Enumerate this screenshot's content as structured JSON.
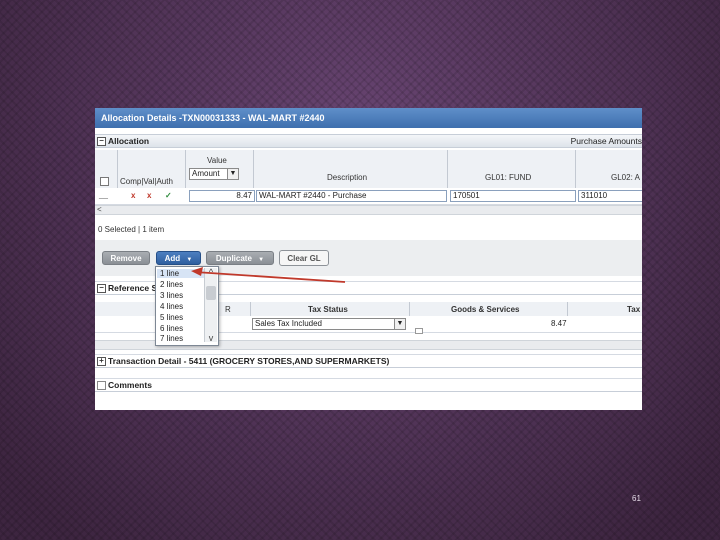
{
  "window": {
    "title": "Allocation Details -TXN00031333 - WAL-MART #2440"
  },
  "allocation": {
    "section_label": "Allocation",
    "right_label": "Purchase Amounts",
    "columns": {
      "value_label": "Value",
      "value_select": "Amount",
      "comp_val_auth": "Comp|Val|Auth",
      "description": "Description",
      "gl01": "GL01: FUND",
      "gl02": "GL02: A"
    },
    "row": {
      "flag1": "x",
      "flag2": "x",
      "flag3": "✓",
      "amount": "8.47",
      "description": "WAL-MART #2440 - Purchase",
      "gl01": "170501",
      "gl02": "311010"
    },
    "scroll_left": "<",
    "selected_text": "0 Selected | 1 item"
  },
  "buttons": {
    "remove": "Remove",
    "add": "Add",
    "add_arrow": "▼",
    "duplicate": "Duplicate",
    "duplicate_arrow": "▼",
    "clear_gl": "Clear GL"
  },
  "add_menu": {
    "items": [
      "1 line",
      "2 lines",
      "3 lines",
      "4 lines",
      "5 lines",
      "6 lines",
      "7 lines"
    ],
    "scroll_up": "^",
    "scroll_down": "v"
  },
  "reference": {
    "section_label": "Reference S",
    "columns": {
      "r": "R",
      "tax_status": "Tax Status",
      "goods_services": "Goods & Services",
      "tax": "Tax"
    },
    "row": {
      "tax_status_value": "Sales Tax Included",
      "amount": "8.47"
    }
  },
  "transaction_detail": {
    "section_label": "Transaction Detail - 5411 (GROCERY STORES,AND SUPERMARKETS)"
  },
  "comments": {
    "section_label": "Comments"
  },
  "slide": {
    "number": "61"
  },
  "colors": {
    "titlebar": "#3e6fae",
    "annotation_arrow": "#c0392b",
    "background": "#5a3a62"
  }
}
